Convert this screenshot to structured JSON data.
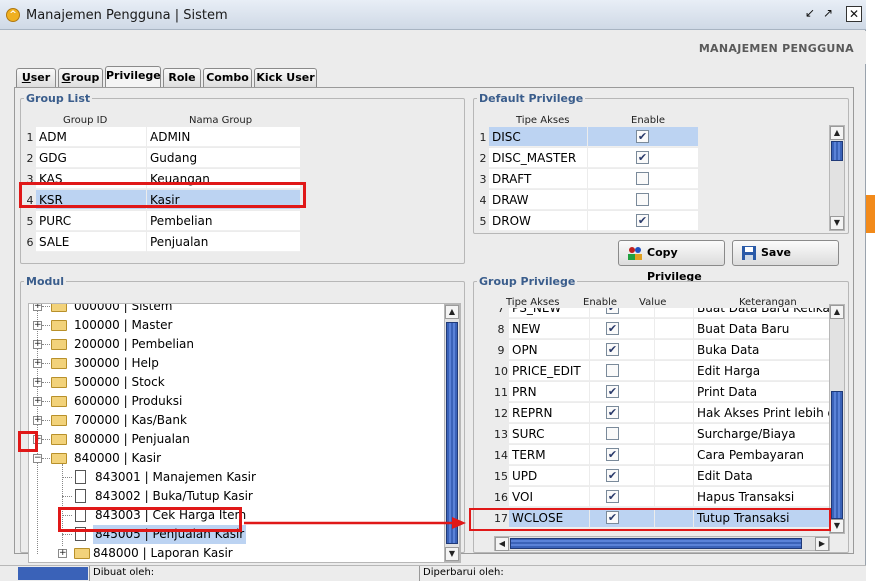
{
  "window": {
    "title": "Manajemen Pengguna | Sistem",
    "header_label": "MANAJEMEN PENGGUNA",
    "icon": "app-icon-orange"
  },
  "tabs": [
    {
      "label": "User",
      "u": "U",
      "rest": "ser"
    },
    {
      "label": "Group",
      "u": "G",
      "rest": "roup"
    },
    {
      "label": "Privilege",
      "u": "",
      "rest": "Privilege"
    },
    {
      "label": "Role",
      "u": "",
      "rest": "Role"
    },
    {
      "label": "Combo",
      "u": "",
      "rest": "Combo"
    },
    {
      "label": "Kick User",
      "u": "",
      "rest": "Kick User"
    }
  ],
  "group_list": {
    "legend": "Group List",
    "col1": "Group ID",
    "col2": "Nama Group",
    "rows": [
      {
        "n": "1",
        "id": "ADM",
        "name": "ADMIN"
      },
      {
        "n": "2",
        "id": "GDG",
        "name": "Gudang"
      },
      {
        "n": "3",
        "id": "KAS",
        "name": "Keuangan"
      },
      {
        "n": "4",
        "id": "KSR",
        "name": "Kasir",
        "selected": true
      },
      {
        "n": "5",
        "id": "PURC",
        "name": "Pembelian"
      },
      {
        "n": "6",
        "id": "SALE",
        "name": "Penjualan"
      }
    ]
  },
  "default_privilege": {
    "legend": "Default Privilege",
    "col1": "Tipe Akses",
    "col2": "Enable",
    "rows": [
      {
        "n": "1",
        "tipe": "DISC",
        "enable": true,
        "selected": true
      },
      {
        "n": "2",
        "tipe": "DISC_MASTER",
        "enable": true
      },
      {
        "n": "3",
        "tipe": "DRAFT",
        "enable": false
      },
      {
        "n": "4",
        "tipe": "DRAW",
        "enable": false
      },
      {
        "n": "5",
        "tipe": "DROW",
        "enable": true
      }
    ]
  },
  "buttons": {
    "copy": "Copy Privilege",
    "save": "Save"
  },
  "modul": {
    "legend": "Modul",
    "nodes": [
      {
        "label": "000000 | Sistem"
      },
      {
        "label": "100000 | Master"
      },
      {
        "label": "200000 | Pembelian"
      },
      {
        "label": "300000 | Help"
      },
      {
        "label": "500000 | Stock"
      },
      {
        "label": "600000 | Produksi"
      },
      {
        "label": "700000 | Kas/Bank"
      },
      {
        "label": "800000 | Penjualan"
      },
      {
        "label": "840000 | Kasir"
      },
      {
        "label": "843001 | Manajemen Kasir"
      },
      {
        "label": "843002 | Buka/Tutup Kasir"
      },
      {
        "label": "843003 | Cek Harga Item"
      },
      {
        "label": "845005 | Penjualan Kasir"
      },
      {
        "label": "848000 | Laporan Kasir"
      }
    ]
  },
  "group_privilege": {
    "legend": "Group Privilege",
    "col1": "Tipe Akses",
    "col2": "Enable",
    "col3": "Value",
    "col4": "Keterangan",
    "rows": [
      {
        "n": "7",
        "tipe": "PS_NEW",
        "enable": true,
        "ket": "Buat Data Baru Ketika Tr"
      },
      {
        "n": "8",
        "tipe": "NEW",
        "enable": true,
        "ket": "Buat Data Baru"
      },
      {
        "n": "9",
        "tipe": "OPN",
        "enable": true,
        "ket": "Buka Data"
      },
      {
        "n": "10",
        "tipe": "PRICE_EDIT",
        "enable": false,
        "ket": "Edit Harga"
      },
      {
        "n": "11",
        "tipe": "PRN",
        "enable": true,
        "ket": "Print Data"
      },
      {
        "n": "12",
        "tipe": "REPRN",
        "enable": true,
        "ket": "Hak Akses Print lebih dari"
      },
      {
        "n": "13",
        "tipe": "SURC",
        "enable": false,
        "ket": "Surcharge/Biaya"
      },
      {
        "n": "14",
        "tipe": "TERM",
        "enable": true,
        "ket": "Cara Pembayaran"
      },
      {
        "n": "15",
        "tipe": "UPD",
        "enable": true,
        "ket": "Edit Data"
      },
      {
        "n": "16",
        "tipe": "VOI",
        "enable": true,
        "ket": "Hapus Transaksi"
      },
      {
        "n": "17",
        "tipe": "WCLOSE",
        "enable": true,
        "ket": "Tutup Transaksi",
        "selected": true
      }
    ]
  },
  "status": {
    "created": "Dibuat oleh:",
    "updated": "Diperbarui oleh:"
  }
}
